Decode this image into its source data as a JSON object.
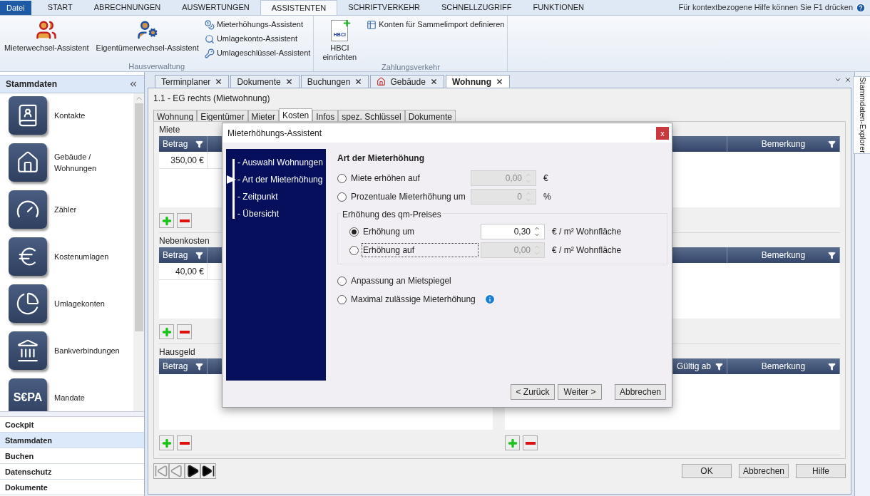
{
  "menu_tabs": [
    {
      "label": "Datei",
      "kind": "file",
      "selected": false
    },
    {
      "label": "START",
      "kind": "tab",
      "selected": false
    },
    {
      "label": "ABRECHNUNGEN",
      "kind": "tab",
      "selected": false
    },
    {
      "label": "AUSWERTUNGEN",
      "kind": "tab",
      "selected": false
    },
    {
      "label": "ASSISTENTEN",
      "kind": "tab",
      "selected": true
    },
    {
      "label": "SCHRIFTVERKEHR",
      "kind": "tab",
      "selected": false
    },
    {
      "label": "SCHNELLZUGRIFF",
      "kind": "tab",
      "selected": false
    },
    {
      "label": "FUNKTIONEN",
      "kind": "tab",
      "selected": false
    }
  ],
  "help_hint": "Für kontextbezogene Hilfe können Sie F1 drücken",
  "ribbon_groups": [
    {
      "title": "Hausverwaltung",
      "items": [
        {
          "kind": "large",
          "label": "Mieterwechsel-Assistent"
        },
        {
          "kind": "large",
          "label": "Eigentümerwechsel-Assistent"
        },
        {
          "kind": "stack",
          "items": [
            "Mieterhöhungs-Assistent",
            "Umlagekonto-Assistent",
            "Umlageschlüssel-Assistent"
          ]
        }
      ]
    },
    {
      "title": "Zahlungsverkehr",
      "items": [
        {
          "kind": "large",
          "label": "HBCI einrichten",
          "icon_text": "HBCI"
        },
        {
          "kind": "stack",
          "items": [
            "Konten für Sammelimport definieren"
          ]
        }
      ]
    }
  ],
  "sidebar": {
    "title": "Stammdaten",
    "items": [
      {
        "label": "Kontakte"
      },
      {
        "label": "Gebäude / Wohnungen"
      },
      {
        "label": "Zähler"
      },
      {
        "label": "Kostenumlagen"
      },
      {
        "label": "Umlagekonten"
      },
      {
        "label": "Bankverbindungen"
      },
      {
        "label": "Mandate",
        "icon_text": "S€PA"
      }
    ],
    "nav": [
      {
        "label": "Cockpit",
        "selected": false
      },
      {
        "label": "Stammdaten",
        "selected": true
      },
      {
        "label": "Buchen",
        "selected": false
      },
      {
        "label": "Datenschutz",
        "selected": false
      },
      {
        "label": "Dokumente",
        "selected": false
      }
    ]
  },
  "doc_tabs": [
    {
      "label": "Terminplaner",
      "selected": false
    },
    {
      "label": "Dokumente",
      "selected": false
    },
    {
      "label": "Buchungen",
      "selected": false
    },
    {
      "label": "Gebäude",
      "selected": false,
      "house_icon": true
    },
    {
      "label": "Wohnung",
      "selected": true
    }
  ],
  "explorer_tab": "Stammdaten-Explorer",
  "pane": {
    "title": "1.1 - EG rechts (Mietwohnung)",
    "tabs": [
      {
        "label": "Wohnung",
        "selected": false
      },
      {
        "label": "Eigentümer",
        "selected": false
      },
      {
        "label": "Mieter",
        "selected": false
      },
      {
        "label": "Kosten",
        "selected": true
      },
      {
        "label": "Infos",
        "selected": false
      },
      {
        "label": "spez. Schlüssel",
        "selected": false
      },
      {
        "label": "Dokumente",
        "selected": false
      }
    ],
    "sections": [
      {
        "title": "Miete",
        "left_columns": [
          "Betrag"
        ],
        "left_rows": [
          "350,00 €"
        ],
        "right_columns": [
          "Bemerkung"
        ]
      },
      {
        "title": "Nebenkosten",
        "left_columns": [
          "Betrag"
        ],
        "left_rows": [
          "40,00 €"
        ],
        "right_columns": [
          "Bemerkung"
        ]
      },
      {
        "title": "Hausgeld",
        "left_columns": [
          "Betrag"
        ],
        "right_columns": [
          "Gültig ab",
          "Bemerkung"
        ]
      }
    ],
    "buttons": [
      "OK",
      "Abbrechen",
      "Hilfe"
    ]
  },
  "dialog": {
    "title": "Mieterhöhungs-Assistent",
    "close": "x",
    "steps": [
      {
        "label": "- Auswahl Wohnungen",
        "selected": false
      },
      {
        "label": "- Art der Mieterhöhung",
        "selected": true
      },
      {
        "label": "- Zeitpunkt",
        "selected": false
      },
      {
        "label": "- Übersicht",
        "selected": false
      }
    ],
    "heading": "Art der Mieterhöhung",
    "options": [
      {
        "kind": "radio",
        "label": "Miete erhöhen auf",
        "selected": false,
        "value": "0,00",
        "disabled": true,
        "unit": "€"
      },
      {
        "kind": "radio",
        "label": "Prozentuale Mieterhöhung um",
        "selected": false,
        "value": "0",
        "disabled": true,
        "unit": "%"
      },
      {
        "kind": "group",
        "title": "Erhöhung des qm-Preises",
        "options": [
          {
            "label": "Erhöhung um",
            "selected": true,
            "focused": false,
            "value": "0,30",
            "disabled": false,
            "unit": "€ / m² Wohnfläche"
          },
          {
            "label": "Erhöhung auf",
            "selected": false,
            "focused": true,
            "value": "0,00",
            "disabled": true,
            "unit": "€ / m² Wohnfläche"
          }
        ]
      },
      {
        "kind": "radio",
        "label": "Anpassung an Mietspiegel",
        "selected": false
      },
      {
        "kind": "radio",
        "label": "Maximal zulässige Mieterhöhung",
        "selected": false,
        "info": true
      }
    ],
    "buttons": [
      "< Zurück",
      "Weiter >",
      "Abbrechen"
    ]
  }
}
